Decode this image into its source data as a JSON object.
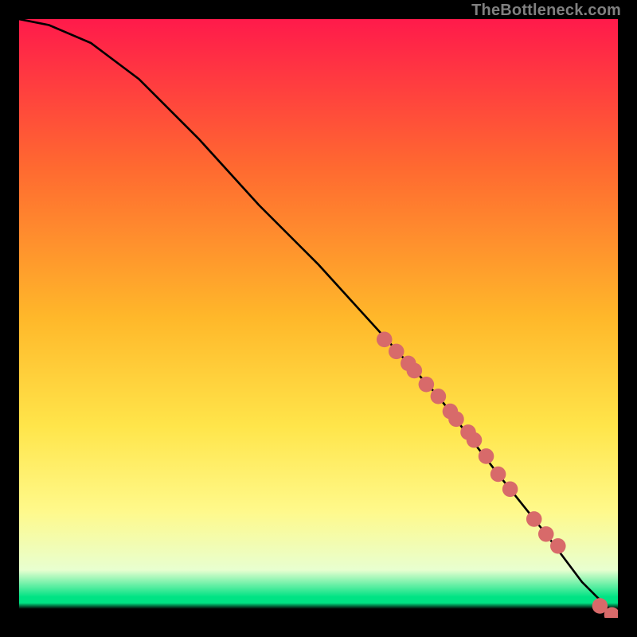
{
  "watermark": "TheBottleneck.com",
  "colors": {
    "top": "#ff1a4b",
    "mid1": "#ff6a30",
    "mid2": "#ffb82a",
    "mid3": "#ffe54a",
    "mid4": "#fff98a",
    "lowpale": "#e8ffd0",
    "green": "#00e384",
    "black": "#000000",
    "dot": "#d86a6a",
    "line": "#000000"
  },
  "chart_data": {
    "type": "line",
    "title": "",
    "xlabel": "",
    "ylabel": "",
    "xlim": [
      0,
      100
    ],
    "ylim": [
      0,
      100
    ],
    "curve": {
      "name": "bottleneck-curve",
      "x": [
        0,
        5,
        12,
        20,
        30,
        40,
        50,
        60,
        70,
        80,
        88,
        94,
        100
      ],
      "y": [
        100,
        99,
        96,
        90,
        80,
        69,
        59,
        48,
        37,
        24,
        14,
        6,
        0
      ]
    },
    "series": [
      {
        "name": "points-on-curve",
        "x": [
          61,
          63,
          65,
          66,
          68,
          70,
          72,
          73,
          75,
          76,
          78,
          80,
          82,
          86,
          88,
          90,
          97,
          99
        ],
        "y": [
          46.5,
          44.5,
          42.5,
          41.3,
          39,
          37,
          34.5,
          33.2,
          31,
          29.7,
          27,
          24,
          21.5,
          16.5,
          14,
          12,
          2,
          0.5
        ]
      }
    ],
    "gradient_stops": [
      {
        "offset": 0.0,
        "key": "top"
      },
      {
        "offset": 0.25,
        "key": "mid1"
      },
      {
        "offset": 0.5,
        "key": "mid2"
      },
      {
        "offset": 0.68,
        "key": "mid3"
      },
      {
        "offset": 0.82,
        "key": "mid4"
      },
      {
        "offset": 0.92,
        "key": "lowpale"
      },
      {
        "offset": 0.965,
        "key": "green"
      },
      {
        "offset": 0.975,
        "key": "green"
      },
      {
        "offset": 0.985,
        "key": "black"
      },
      {
        "offset": 1.0,
        "key": "black"
      }
    ]
  }
}
